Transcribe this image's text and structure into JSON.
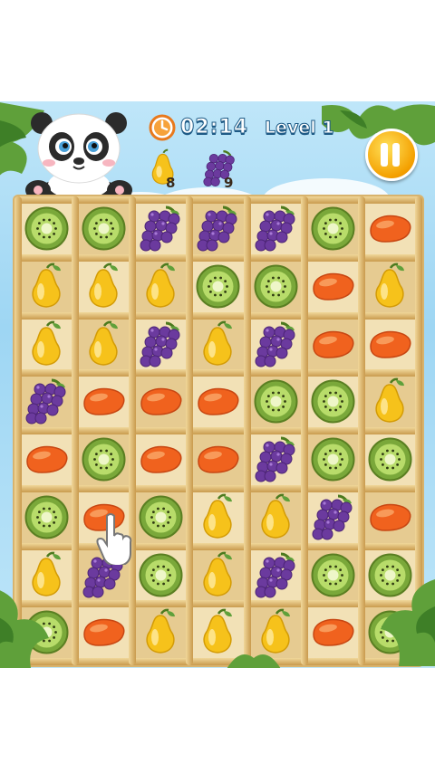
{
  "hud": {
    "timer": "02:14",
    "level": "Level 1",
    "goals": [
      {
        "fruit": "pear",
        "count": "8"
      },
      {
        "fruit": "grape",
        "count": "9"
      }
    ],
    "timer_icon": "clock-icon",
    "pause_icon": "pause-icon"
  },
  "board": {
    "rows": 8,
    "cols": 7,
    "grid": [
      [
        "kiwi",
        "kiwi",
        "grape",
        "grape",
        "grape",
        "kiwi",
        "mango"
      ],
      [
        "pear",
        "pear",
        "pear",
        "kiwi",
        "kiwi",
        "mango",
        "pear"
      ],
      [
        "pear",
        "pear",
        "grape",
        "pear",
        "grape",
        "mango",
        "mango"
      ],
      [
        "grape",
        "mango",
        "mango",
        "mango",
        "kiwi",
        "kiwi",
        "pear"
      ],
      [
        "mango",
        "kiwi",
        "mango",
        "mango",
        "grape",
        "kiwi",
        "kiwi"
      ],
      [
        "kiwi",
        "mango",
        "kiwi",
        "pear",
        "pear",
        "grape",
        "mango"
      ],
      [
        "pear",
        "grape",
        "kiwi",
        "pear",
        "grape",
        "kiwi",
        "kiwi"
      ],
      [
        "kiwi",
        "mango",
        "pear",
        "pear",
        "pear",
        "mango",
        "kiwi"
      ]
    ]
  },
  "colors": {
    "kiwi_skin": "#7aa83a",
    "kiwi_flesh": "#b8dc6a",
    "grape": "#6b3a9e",
    "pear": "#f6c21b",
    "mango": "#f0621e",
    "pause": "#f4a000"
  },
  "cursor": {
    "type": "hand-pointer-icon"
  }
}
